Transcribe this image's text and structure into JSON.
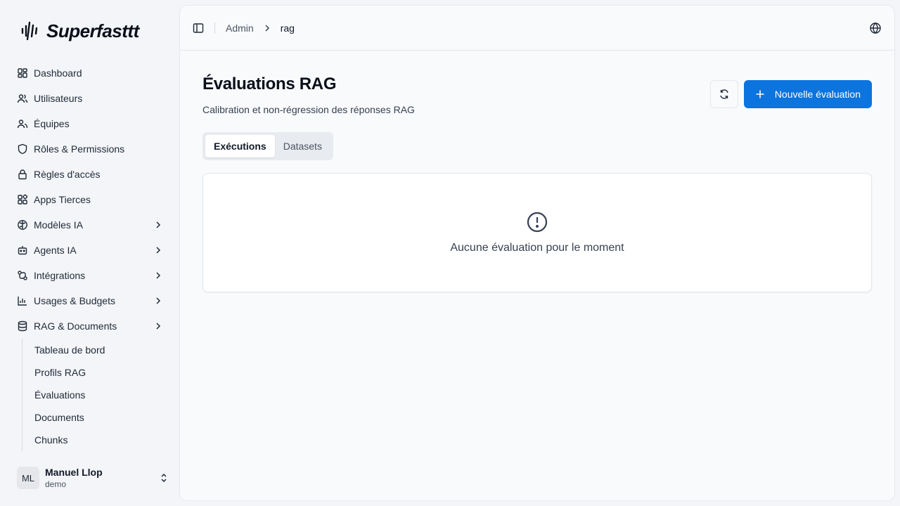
{
  "brand": {
    "name": "Superfasttt"
  },
  "sidebar": {
    "items": [
      {
        "label": "Dashboard",
        "icon": "dashboard-icon"
      },
      {
        "label": "Utilisateurs",
        "icon": "users-icon"
      },
      {
        "label": "Équipes",
        "icon": "teams-icon"
      },
      {
        "label": "Rôles & Permissions",
        "icon": "shield-icon"
      },
      {
        "label": "Règles d'accès",
        "icon": "lock-icon"
      },
      {
        "label": "Apps Tierces",
        "icon": "apps-icon"
      },
      {
        "label": "Modèles IA",
        "icon": "brain-icon"
      },
      {
        "label": "Agents IA",
        "icon": "bot-icon"
      },
      {
        "label": "Intégrations",
        "icon": "integrations-icon"
      },
      {
        "label": "Usages & Budgets",
        "icon": "bar-chart-icon"
      },
      {
        "label": "RAG & Documents",
        "icon": "database-icon"
      }
    ],
    "rag_subitems": [
      {
        "label": "Tableau de bord"
      },
      {
        "label": "Profils RAG"
      },
      {
        "label": "Évaluations"
      },
      {
        "label": "Documents"
      },
      {
        "label": "Chunks"
      }
    ]
  },
  "user": {
    "initials": "ML",
    "name": "Manuel Llop",
    "role": "demo"
  },
  "breadcrumb": {
    "parent": "Admin",
    "current": "rag"
  },
  "page": {
    "title": "Évaluations RAG",
    "subtitle": "Calibration et non-régression des réponses RAG",
    "new_button": "Nouvelle évaluation",
    "tabs": [
      {
        "label": "Exécutions",
        "active": true
      },
      {
        "label": "Datasets",
        "active": false
      }
    ],
    "empty_message": "Aucune évaluation pour le moment"
  },
  "colors": {
    "accent": "#0b74de",
    "background": "#f3f5f8"
  }
}
